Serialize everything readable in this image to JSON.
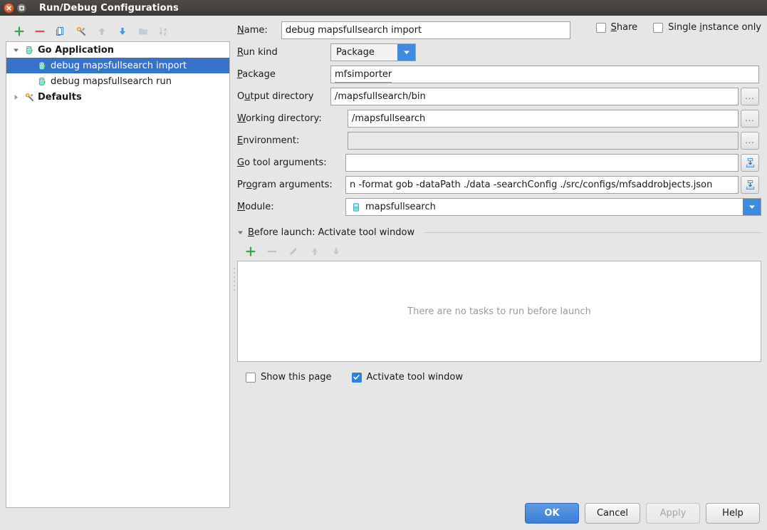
{
  "window": {
    "title": "Run/Debug Configurations",
    "close_icon": "close-icon",
    "maximize_icon": "maximize-icon"
  },
  "tree_toolbar": {
    "buttons": [
      {
        "name": "add-configuration-button",
        "icon": "plus-icon",
        "enabled": true
      },
      {
        "name": "remove-configuration-button",
        "icon": "minus-icon",
        "enabled": true
      },
      {
        "name": "copy-configuration-button",
        "icon": "copy-icon",
        "enabled": true
      },
      {
        "name": "edit-defaults-button",
        "icon": "wrench-icon",
        "enabled": true
      },
      {
        "name": "move-up-button",
        "icon": "arrow-up-icon",
        "enabled": false
      },
      {
        "name": "move-down-button",
        "icon": "arrow-down-icon",
        "enabled": true
      },
      {
        "name": "create-folder-button",
        "icon": "folder-icon",
        "enabled": false
      },
      {
        "name": "sort-configurations-button",
        "icon": "sort-alpha-icon",
        "enabled": false
      }
    ]
  },
  "tree": {
    "nodes": [
      {
        "label": "Go Application",
        "icon": "go-gopher-icon",
        "level": 0,
        "expanded": true,
        "bold": true,
        "selected": false,
        "has_arrow": true
      },
      {
        "label": "debug mapsfullsearch import",
        "icon": "go-gopher-icon",
        "level": 1,
        "bold": false,
        "selected": true,
        "has_arrow": false
      },
      {
        "label": "debug mapsfullsearch run",
        "icon": "go-gopher-icon",
        "level": 1,
        "bold": false,
        "selected": false,
        "has_arrow": false
      },
      {
        "label": "Defaults",
        "icon": "wrench-icon",
        "level": 0,
        "expanded": false,
        "bold": true,
        "selected": false,
        "has_arrow": true
      }
    ]
  },
  "form": {
    "name": {
      "label": "Name:",
      "mnemonic": "N",
      "value": "debug mapsfullsearch import"
    },
    "share": {
      "label": "Share",
      "mnemonic": "S",
      "checked": false
    },
    "single_instance": {
      "label": "Single instance only",
      "mnemonic": "i",
      "checked": false
    },
    "run_kind": {
      "label": "Run kind",
      "mnemonic": "R",
      "value": "Package"
    },
    "package": {
      "label": "Package",
      "mnemonic": "P",
      "value": "mfsimporter",
      "misspelled": true
    },
    "output_directory": {
      "label": "Output directory",
      "mnemonic": "u",
      "value": "/mapsfullsearch/bin",
      "browse": "..."
    },
    "working_directory": {
      "label": "Working directory:",
      "mnemonic": "W",
      "value": "/mapsfullsearch",
      "browse": "..."
    },
    "environment": {
      "label": "Environment:",
      "mnemonic": "E",
      "value": "",
      "browse": "...",
      "disabled": true
    },
    "go_tool_arguments": {
      "label": "Go tool arguments:",
      "mnemonic": "G",
      "value": "",
      "expand_icon": "expand-field-icon"
    },
    "program_arguments": {
      "label": "Program arguments:",
      "mnemonic": "o",
      "value": "n -format gob -dataPath ./data -searchConfig ./src/configs/mfsaddrobjects.json",
      "expand_icon": "expand-field-icon"
    },
    "module": {
      "label": "Module:",
      "mnemonic": "M",
      "value": "mapsfullsearch",
      "icon": "module-icon"
    }
  },
  "before_launch": {
    "title": "Before launch: Activate tool window",
    "mnemonic": "B",
    "collapse_icon": "triangle-down-icon",
    "toolbar": [
      {
        "name": "add-task-button",
        "icon": "plus-icon",
        "enabled": true
      },
      {
        "name": "remove-task-button",
        "icon": "minus-icon",
        "enabled": false
      },
      {
        "name": "edit-task-button",
        "icon": "pencil-icon",
        "enabled": false
      },
      {
        "name": "move-task-up-button",
        "icon": "arrow-up-icon",
        "enabled": false
      },
      {
        "name": "move-task-down-button",
        "icon": "arrow-down-icon",
        "enabled": false
      }
    ],
    "empty_text": "There are no tasks to run before launch",
    "show_this_page": {
      "label": "Show this page",
      "checked": false
    },
    "activate_tool_window": {
      "label": "Activate tool window",
      "checked": true
    }
  },
  "footer": {
    "ok": "OK",
    "cancel": "Cancel",
    "apply": "Apply",
    "apply_enabled": false,
    "help": "Help"
  },
  "colors": {
    "selection_blue": "#3573c8",
    "accent_blue": "#3f8ae0",
    "titlebar": "#3c3936",
    "dialog_bg": "#e6e6e6"
  }
}
